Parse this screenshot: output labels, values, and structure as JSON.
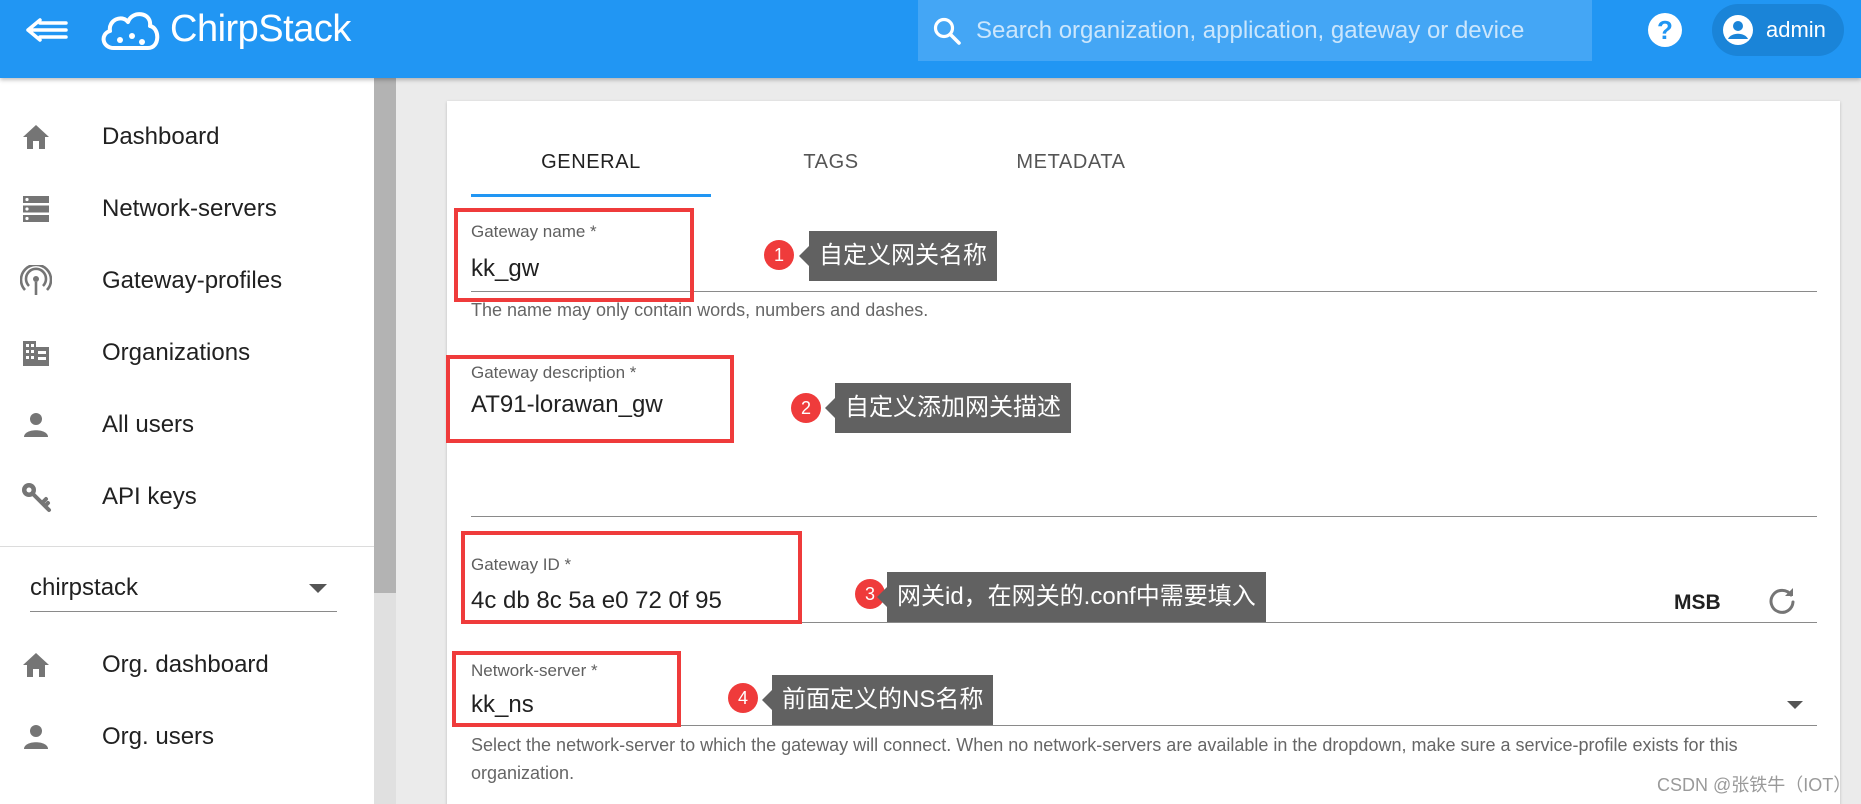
{
  "app": {
    "brand_name": "ChirpStack",
    "search_placeholder": "Search organization, application, gateway or device",
    "help_icon": "?",
    "user_label": "admin"
  },
  "sidebar": {
    "items": [
      {
        "label": "Dashboard",
        "icon": "home-icon"
      },
      {
        "label": "Network-servers",
        "icon": "server-icon"
      },
      {
        "label": "Gateway-profiles",
        "icon": "radio-tower-icon"
      },
      {
        "label": "Organizations",
        "icon": "domain-icon"
      },
      {
        "label": "All users",
        "icon": "account-icon"
      },
      {
        "label": "API keys",
        "icon": "key-icon"
      }
    ],
    "organization_selector": {
      "value": "chirpstack"
    },
    "org_items": [
      {
        "label": "Org. dashboard",
        "icon": "home-icon"
      },
      {
        "label": "Org. users",
        "icon": "account-icon"
      }
    ]
  },
  "tabs": [
    {
      "label": "GENERAL",
      "active": true
    },
    {
      "label": "TAGS",
      "active": false
    },
    {
      "label": "METADATA",
      "active": false
    }
  ],
  "form": {
    "gateway_name": {
      "label": "Gateway name *",
      "value": "kk_gw",
      "helper": "The name may only contain words, numbers and dashes."
    },
    "gateway_description": {
      "label": "Gateway description *",
      "value": "AT91-lorawan_gw"
    },
    "gateway_id": {
      "label": "Gateway ID *",
      "value": "4c db 8c 5a e0 72 0f 95",
      "byte_order": "MSB"
    },
    "network_server": {
      "label": "Network-server *",
      "value": "kk_ns",
      "helper": "Select the network-server to which the gateway will connect. When no network-servers are available in the dropdown, make sure a service-profile exists for this organization."
    }
  },
  "annotations": [
    {
      "number": "1",
      "text": "自定义网关名称"
    },
    {
      "number": "2",
      "text": "自定义添加网关描述"
    },
    {
      "number": "3",
      "text": "网关id，在网关的.conf中需要填入"
    },
    {
      "number": "4",
      "text": "前面定义的NS名称"
    }
  ],
  "watermark": "CSDN @张铁牛（IOT）",
  "colors": {
    "app_bar": "#2196f3",
    "annotation_red": "#ef3b3b",
    "callout_gray": "#616161"
  }
}
